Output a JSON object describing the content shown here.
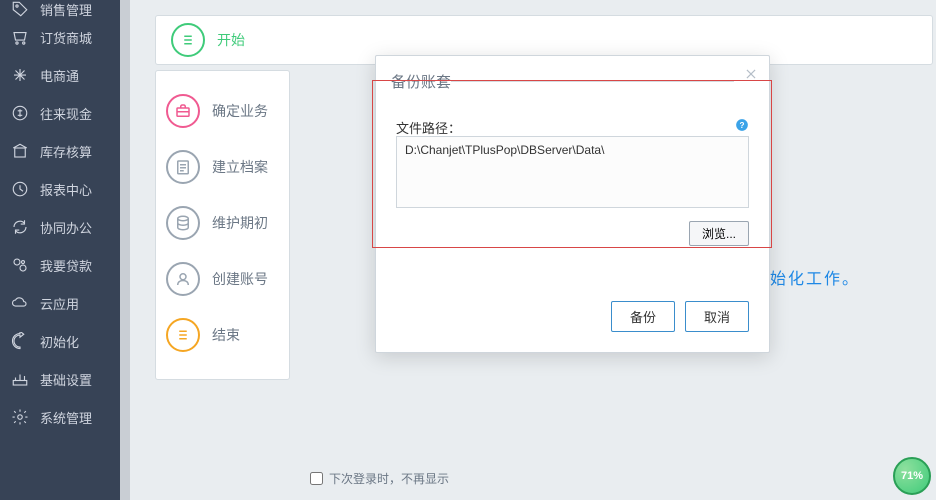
{
  "sidebar": {
    "items": [
      {
        "label": "销售管理",
        "icon": "tag"
      },
      {
        "label": "订货商城",
        "icon": "cart"
      },
      {
        "label": "电商通",
        "icon": "link"
      },
      {
        "label": "往来现金",
        "icon": "coin"
      },
      {
        "label": "库存核算",
        "icon": "building"
      },
      {
        "label": "报表中心",
        "icon": "clock"
      },
      {
        "label": "协同办公",
        "icon": "sync"
      },
      {
        "label": "我要贷款",
        "icon": "money"
      },
      {
        "label": "云应用",
        "icon": "cloud"
      },
      {
        "label": "初始化",
        "icon": "refresh"
      },
      {
        "label": "基础设置",
        "icon": "settings"
      },
      {
        "label": "系统管理",
        "icon": "gear"
      }
    ]
  },
  "steps": [
    {
      "label": "开始",
      "color": "green"
    },
    {
      "label": "确定业务",
      "color": "pink"
    },
    {
      "label": "建立档案",
      "color": "gray"
    },
    {
      "label": "维护期初",
      "color": "gray"
    },
    {
      "label": "创建账号",
      "color": "gray"
    },
    {
      "label": "结束",
      "color": "yellow"
    }
  ],
  "main": {
    "blue_text": "始化工作。"
  },
  "modal": {
    "title": "备份账套",
    "path_label": "文件路径：",
    "path_value": "D:\\Chanjet\\TPlusPop\\DBServer\\Data\\",
    "browse_label": "浏览...",
    "backup_label": "备份",
    "cancel_label": "取消"
  },
  "footer": {
    "checkbox_label": "下次登录时，不再显示"
  },
  "badge": {
    "percent": "71%"
  }
}
